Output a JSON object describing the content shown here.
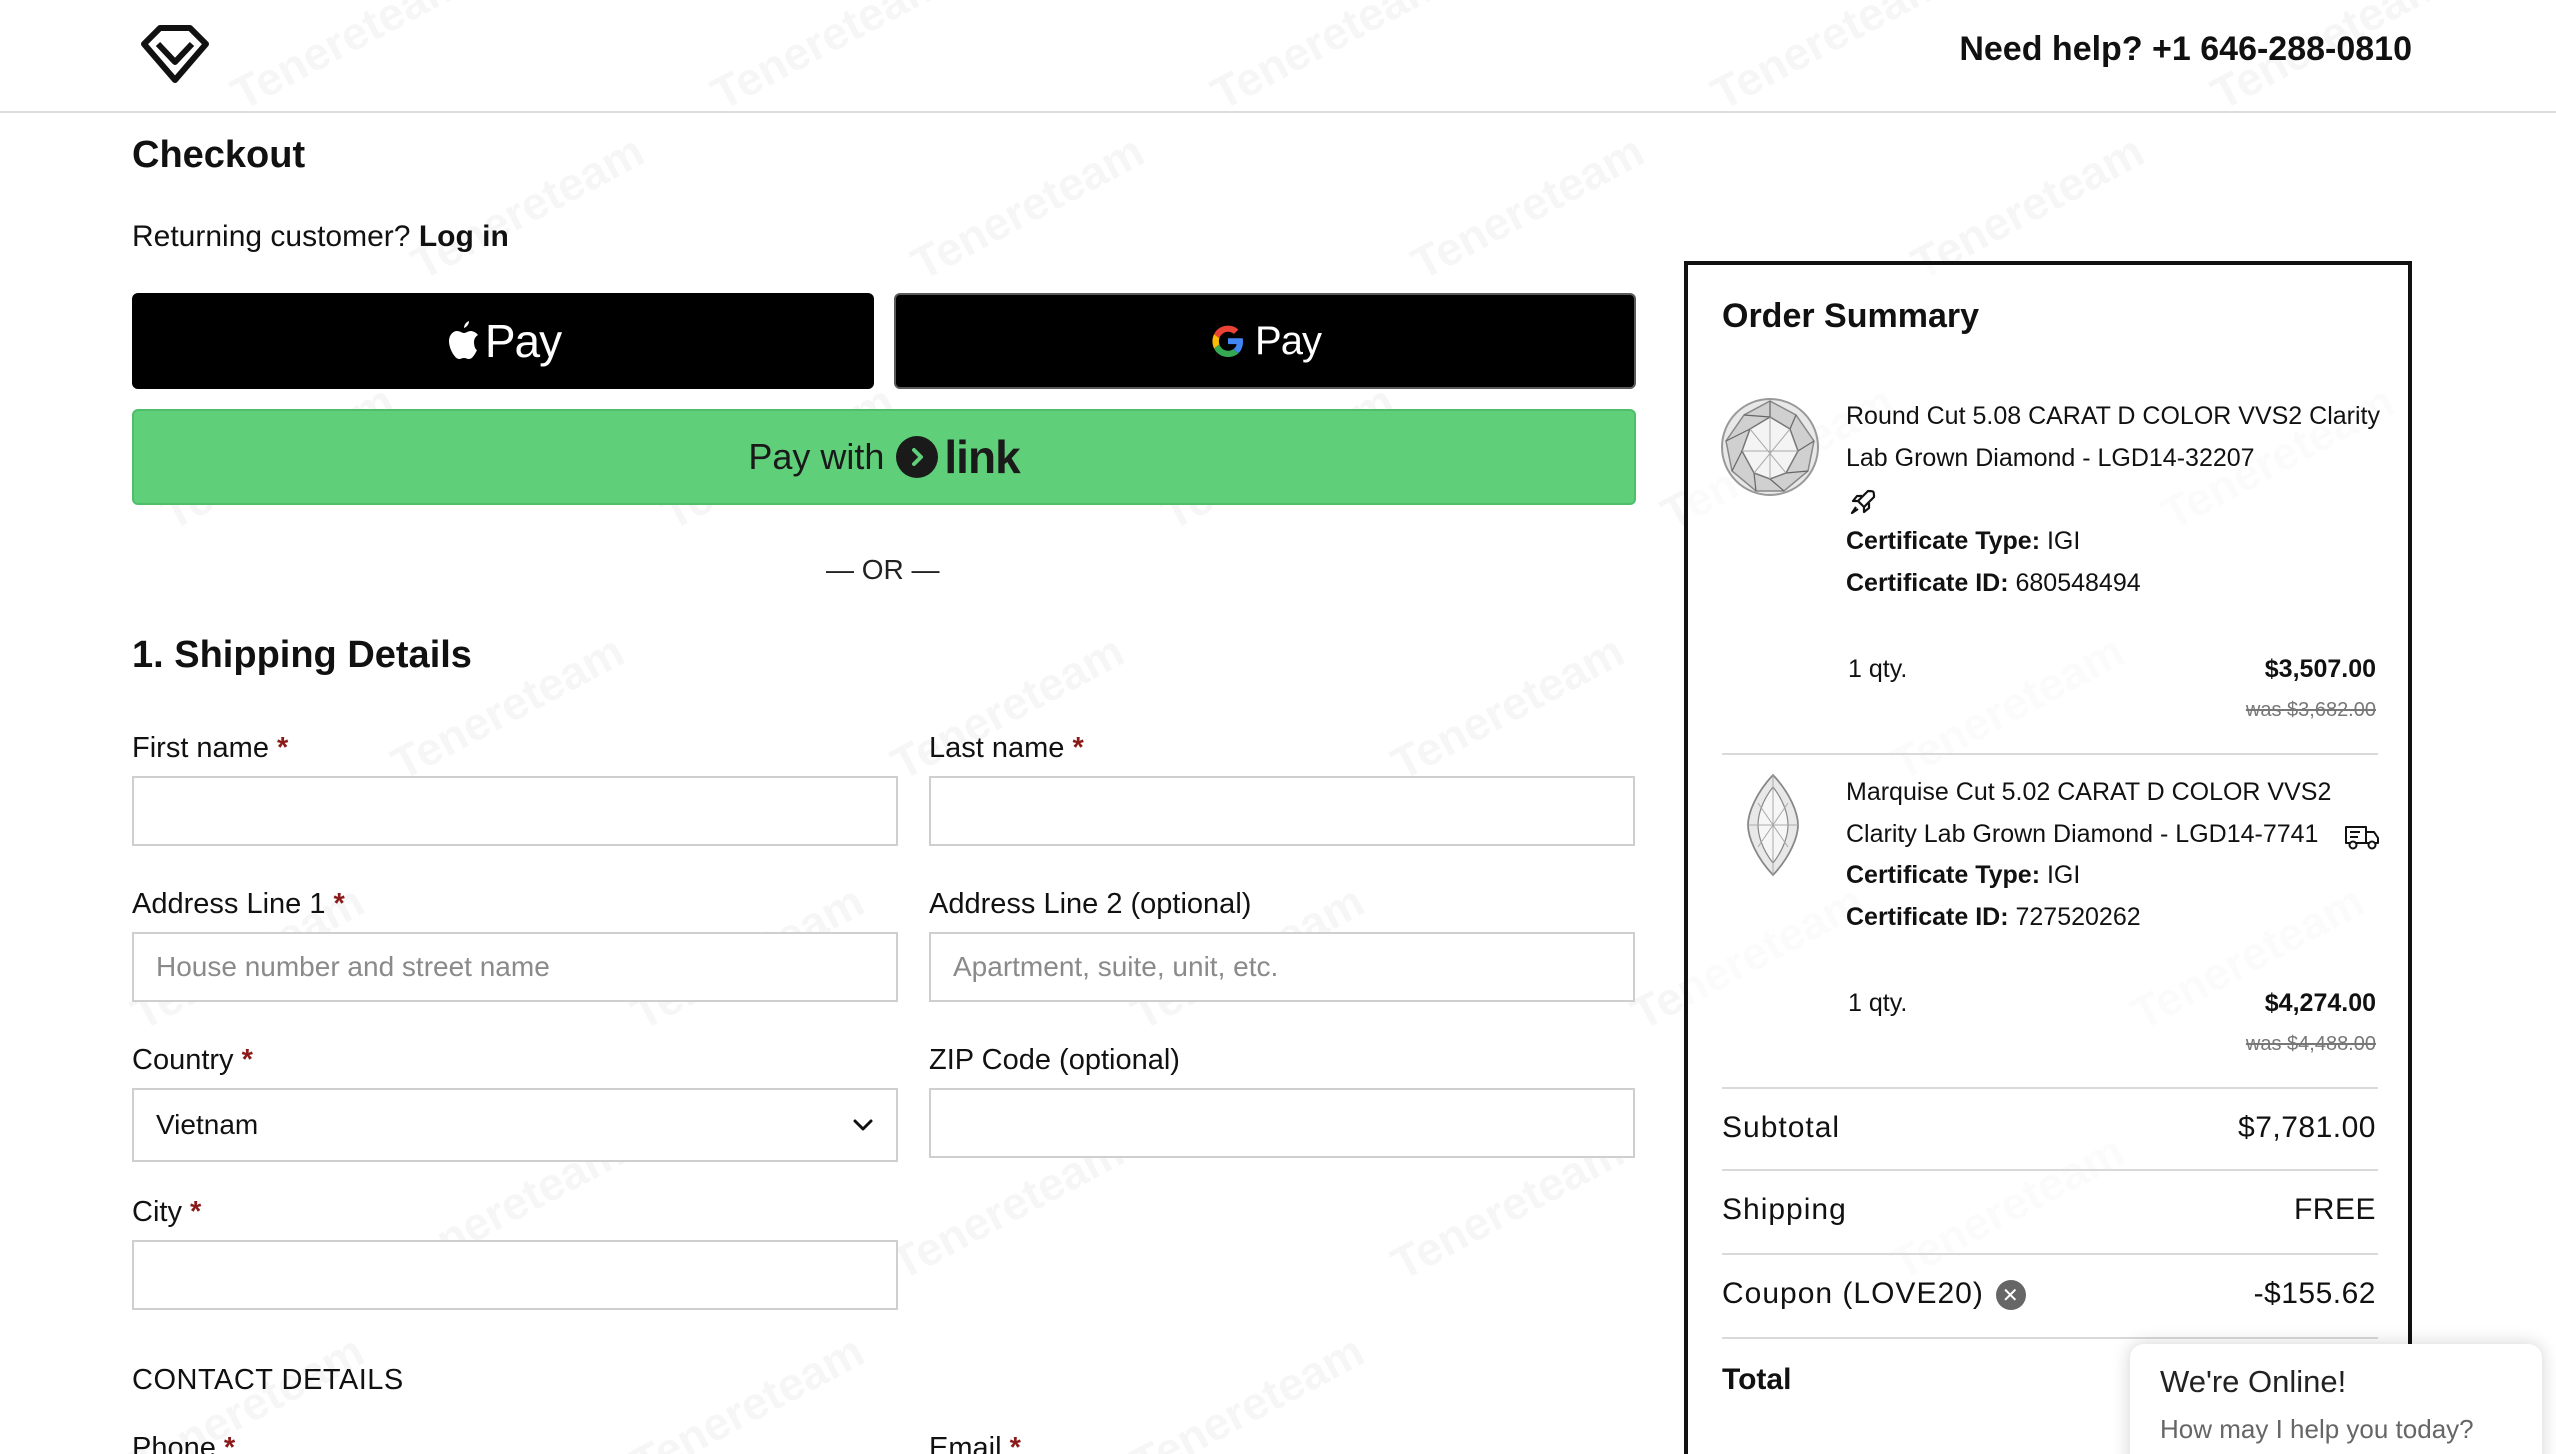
{
  "header": {
    "help_text": "Need help? +1 646-288-0810"
  },
  "checkout": {
    "title": "Checkout",
    "returning_text": "Returning customer?",
    "login_link": "Log in",
    "apple_pay_label": "Pay",
    "google_pay_label": "Pay",
    "link_pay_prefix": "Pay with",
    "link_pay_brand": "link",
    "or_divider": "— OR —"
  },
  "shipping": {
    "section_title": "1. Shipping Details",
    "first_name_label": "First name",
    "last_name_label": "Last name",
    "address1_label": "Address Line 1",
    "address1_placeholder": "House number and street name",
    "address2_label": "Address Line 2 (optional)",
    "address2_placeholder": "Apartment, suite, unit, etc.",
    "country_label": "Country",
    "country_value": "Vietnam",
    "zip_label": "ZIP Code (optional)",
    "city_label": "City",
    "required_mark": "*"
  },
  "contact": {
    "section_title": "CONTACT DETAILS",
    "phone_label": "Phone",
    "email_label": "Email"
  },
  "summary": {
    "title": "Order Summary",
    "items": [
      {
        "title": "Round Cut 5.08 CARAT D COLOR VVS2 Clarity Lab Grown Diamond - LGD14-32207",
        "cert_type_label": "Certificate Type:",
        "cert_type": "IGI",
        "cert_id_label": "Certificate ID:",
        "cert_id": "680548494",
        "qty": "1 qty.",
        "price": "$3,507.00",
        "was": "was $3,682.00",
        "badge_icon": "rocket-icon"
      },
      {
        "title": "Marquise Cut 5.02 CARAT D COLOR VVS2 Clarity Lab Grown Diamond - LGD14-7741",
        "cert_type_label": "Certificate Type:",
        "cert_type": "IGI",
        "cert_id_label": "Certificate ID:",
        "cert_id": "727520262",
        "qty": "1 qty.",
        "price": "$4,274.00",
        "was": "was $4,488.00",
        "badge_icon": "truck-icon"
      }
    ],
    "subtotal_label": "Subtotal",
    "subtotal_value": "$7,781.00",
    "shipping_label": "Shipping",
    "shipping_value": "FREE",
    "coupon_label": "Coupon (LOVE20)",
    "coupon_value": "-$155.62",
    "total_label": "Total"
  },
  "chat": {
    "title": "We're Online!",
    "subtitle": "How may I help you today?"
  },
  "colors": {
    "link_green": "#5fcf7a",
    "required_red": "#8b1a1a",
    "pay_black": "#000000"
  }
}
